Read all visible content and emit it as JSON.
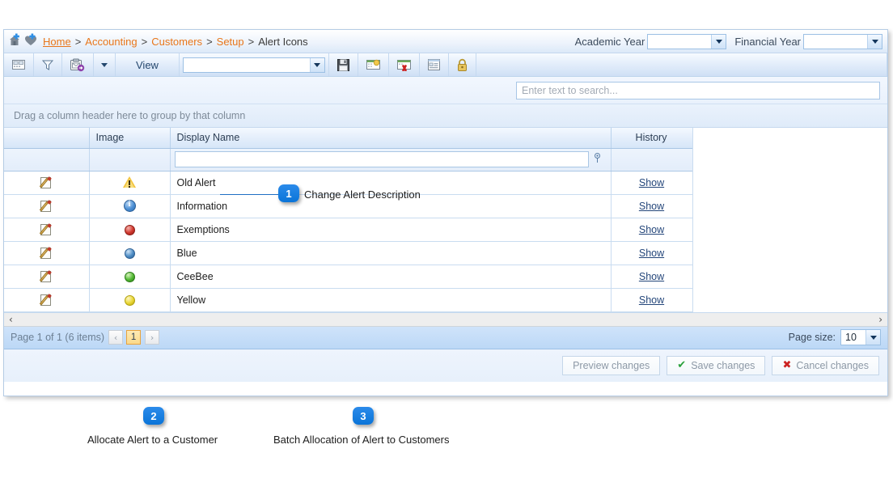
{
  "breadcrumb": {
    "home": "Home",
    "sep": ">",
    "items": [
      "Accounting",
      "Customers",
      "Setup"
    ],
    "current": "Alert Icons"
  },
  "header": {
    "academic_year_label": "Academic Year",
    "academic_year_value": "",
    "financial_year_label": "Financial Year",
    "financial_year_value": ""
  },
  "toolbar": {
    "layout_icon": "columns-layout-icon",
    "filter_icon": "funnel-icon",
    "export_icon": "export-clipboard-icon",
    "view_label": "View",
    "view_value": "",
    "save_icon": "floppy-disk-icon",
    "new_icon": "new-record-icon",
    "delete_icon": "delete-record-icon",
    "details_icon": "details-icon",
    "lock_icon": "padlock-icon"
  },
  "search": {
    "placeholder": "Enter text to search...",
    "value": ""
  },
  "group_bar": {
    "text": "Drag a column header here to group by that column"
  },
  "grid": {
    "columns": [
      "",
      "Image",
      "Display Name",
      "History"
    ],
    "filter_value": "",
    "filter_icon": "filter-options-icon",
    "rows": [
      {
        "edit_icon": "edit-pencil-icon",
        "image_icon": "warning-triangle-icon",
        "image_kind": "triangle",
        "name": "Old Alert",
        "history": "Show"
      },
      {
        "edit_icon": "edit-pencil-icon",
        "image_icon": "information-icon",
        "image_kind": "info",
        "name": "Information",
        "history": "Show"
      },
      {
        "edit_icon": "edit-pencil-icon",
        "image_icon": "red-ball-icon",
        "image_kind": "red",
        "name": "Exemptions",
        "history": "Show"
      },
      {
        "edit_icon": "edit-pencil-icon",
        "image_icon": "blue-ball-icon",
        "image_kind": "blue",
        "name": "Blue",
        "history": "Show"
      },
      {
        "edit_icon": "edit-pencil-icon",
        "image_icon": "green-ball-icon",
        "image_kind": "green",
        "name": "CeeBee",
        "history": "Show"
      },
      {
        "edit_icon": "edit-pencil-icon",
        "image_icon": "yellow-ball-icon",
        "image_kind": "yellow",
        "name": "Yellow",
        "history": "Show"
      }
    ]
  },
  "scrollbar": {
    "left_arrow": "‹",
    "right_arrow": "›"
  },
  "pager": {
    "status": "Page 1 of 1 (6 items)",
    "prev": "‹",
    "current_page": "1",
    "next": "›",
    "page_size_label": "Page size:",
    "page_size_value": "10"
  },
  "footer": {
    "preview_label": "Preview changes",
    "save_label": "Save changes",
    "cancel_label": "Cancel changes",
    "save_icon": "green-check-icon",
    "cancel_icon": "red-cross-icon"
  },
  "callouts": [
    {
      "number": "1",
      "text": "Change Alert Description"
    },
    {
      "number": "2",
      "text": "Allocate Alert to a Customer"
    },
    {
      "number": "3",
      "text": "Batch Allocation of Alert to Customers"
    }
  ],
  "colors": {
    "accent_orange": "#e8761a",
    "callout_blue": "#0a74d8",
    "link_blue": "#24467a",
    "page_highlight": "#e8a33d"
  }
}
